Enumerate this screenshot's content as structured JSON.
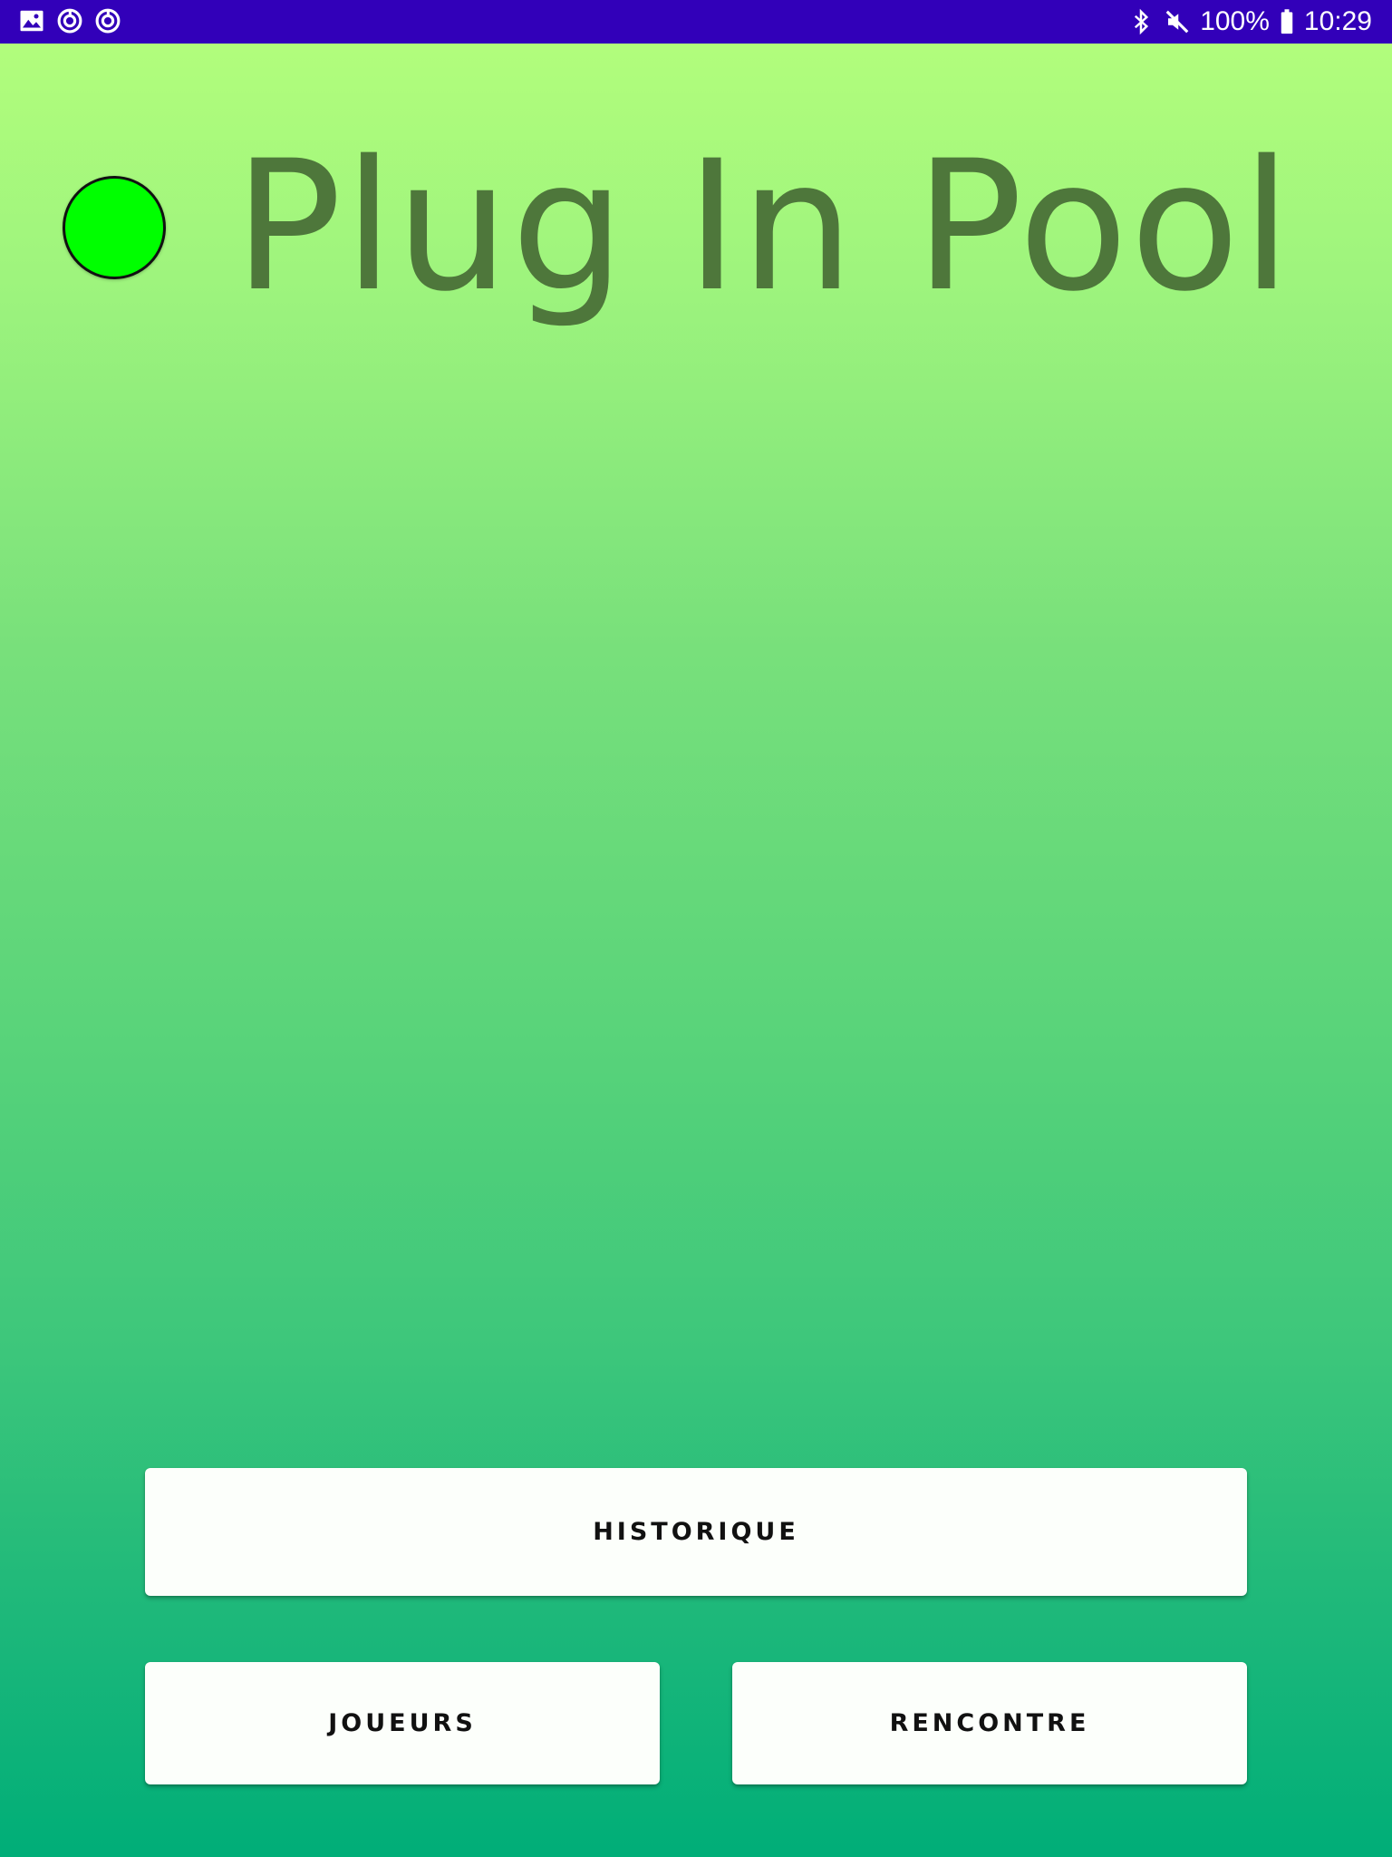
{
  "status_bar": {
    "battery": "100%",
    "time": "10:29",
    "icons_left": [
      "image-icon",
      "sync-icon",
      "sync-icon"
    ],
    "icons_right": [
      "bluetooth-icon",
      "mute-icon",
      "battery-icon"
    ],
    "background": "#3200b9"
  },
  "app": {
    "title": "Plug In Pool",
    "status_dot_color": "#00ff00",
    "title_color": "#4e773b"
  },
  "buttons": {
    "historique": "HISTORIQUE",
    "joueurs": "JOUEURS",
    "rencontre": "RENCONTRE"
  }
}
